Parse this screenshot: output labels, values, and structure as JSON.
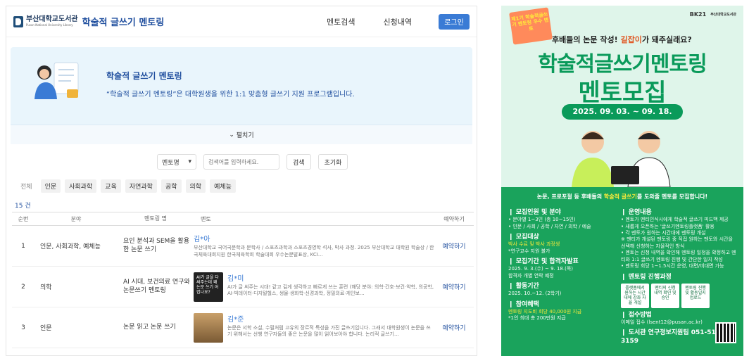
{
  "app": {
    "logo_kr": "부산대학교도서관",
    "logo_en": "Pusan National University Library",
    "title": "학술적 글쓰기 멘토링",
    "nav": [
      "멘토검색",
      "신청내역"
    ],
    "login_label": "로그인"
  },
  "hero": {
    "title": "학술적 글쓰기 멘토링",
    "desc": "“학술적 글쓰기 멘토링”은 대학원생을 위한 1:1 맞춤형 글쓰기 지원 프로그램입니다.",
    "collapse_label": "펼치기",
    "collapse_icon": "chevron-down-icon"
  },
  "search": {
    "select_value": "멘토명",
    "placeholder": "검색어를 입력하세요.",
    "search_label": "검색",
    "reset_label": "초기화"
  },
  "filters": [
    "전체",
    "인문",
    "사회과학",
    "교육",
    "자연과학",
    "공학",
    "의학",
    "예체능"
  ],
  "count_label": "15 건",
  "table": {
    "headers": [
      "순번",
      "분야",
      "멘토링 명",
      "멘토",
      "예약하기"
    ],
    "rows": [
      {
        "no": "1",
        "field": "인문, 사회과학, 예체능",
        "name": "요인 분석과 SEM을 활용한 논문 쓰기",
        "mentor": "김*아",
        "desc": "부산대학교 국어국문학과 문학사 / 스포츠과학과 스포츠경영학 석사, 박사 과정. 2025 부산대학교 대학원 학술상 / 한국체육대회지원 한국체육학회 학술대회 우수논문발표상, KCI...",
        "action": "예약하기"
      },
      {
        "no": "2",
        "field": "의학",
        "name": "AI 시대, 보건의료 연구와 논문쓰기 멘토링",
        "mentor": "김*미",
        "thumb_text": "AI가 글을 다 써주는데 왜 논문 쓰기 어렵나요?",
        "desc": "AI가 글 써주는 시대! 같고 깊게 생각하고 빠르게 쓰는 훈련 (해당 분야: 의학·간호·보건·약학, 의공학, AI·빅데이터·디지털헬스, 생물·생화학·신경과학, 정밀의료·게인보...",
        "action": "예약하기"
      },
      {
        "no": "3",
        "field": "인문",
        "name": "논문 읽고 논문 쓰기",
        "mentor": "김*준",
        "desc": "논문은 서학 소설, 수필처럼 고유의 장르적 특성을 가진 글쓰기입니다. 그래서 대학원생이 논문을 쓰기 위해서는 선행 연구자들의 좋은 논문을 많이 읽어보아야 합니다. 논리적 글쓰기...",
        "action": "예약하기"
      }
    ]
  },
  "poster": {
    "badge": "제1기 학술적글쓰기 멘토링 우수 멘토",
    "partner1": "BK21",
    "partner2": "부산대학교도서관",
    "sub_head_a": "후배들의 논문 작성! ",
    "sub_head_hl": "길잡이",
    "sub_head_b": "가 돼주실래요?",
    "big1": "학술적글쓰기멘토링",
    "big2": "멘토모집",
    "date": "2025. 09. 03. ~ 09. 18.",
    "band_head_a": "논문, 프로포절 등 후배들의 ",
    "band_head_hl": "학술적 글쓰기",
    "band_head_b": "를 도와줄 멘토를 모집합니다!",
    "left": {
      "s1": "모집인원 및 분야",
      "s1_items": [
        "• 분야별 1~3인 (총 10~15인)",
        "• 인문 / 사회 / 공학 / 자연 / 의학 / 예술"
      ],
      "s2": "모집대상",
      "s2_items": [
        "박사 수료 및 박사 과정생",
        "*연구교수 지원 불가"
      ],
      "s3": "모집기간 및 합격자발표",
      "s3_items": [
        "2025. 9. 3.(수) ~ 9. 18.(목)",
        "합격자 개별 연락 예정"
      ],
      "s4": "활동기간",
      "s4_items": [
        "2025. 10.~12. (2학기)"
      ],
      "s5": "참여혜택",
      "s5_items": [
        "멘토링 지도비 회당 40,000원 지급",
        "*1인 최대 총 200만원 지급"
      ]
    },
    "right": {
      "s1": "운영내용",
      "s1_items": [
        "• 멘토가 멘티인식시에게 학술적 글쓰기 피드백 제공",
        "• 새롭게 오픈하는 '글쓰기멘토링플랫폼' 활용",
        "• 각 멘토가 원하는 시간대에 멘토링 개설",
        "※ 멘티가 개설된 멘토링 중 직접 원하는 멘토와 시간을 선택해 신청하는 자율적인 방식",
        "• 멘토는 신청 내역을 확인해 멘토링 일정을 확정하고 멘티와 1:1 글쓰기 멘토링 진행 및 간단한 일지 작성",
        "• 멘토링 회당 1~1.5시간 운영, 대면/비대면 가능"
      ],
      "s2": "멘토링 진행과정",
      "flow": [
        "플랫폼에서 원하는 시간대에 강좌 자율 개설",
        "멘티의 신청 내역 확인 및 승인",
        "멘토링 진행 및 활동일지 업로드"
      ],
      "s3": "접수방법",
      "s3_items": [
        "이메일 접수 (lsent12@pusan.ac.kr)"
      ],
      "footer": "도서관 연구정보지원팀 051-510-3159"
    }
  }
}
